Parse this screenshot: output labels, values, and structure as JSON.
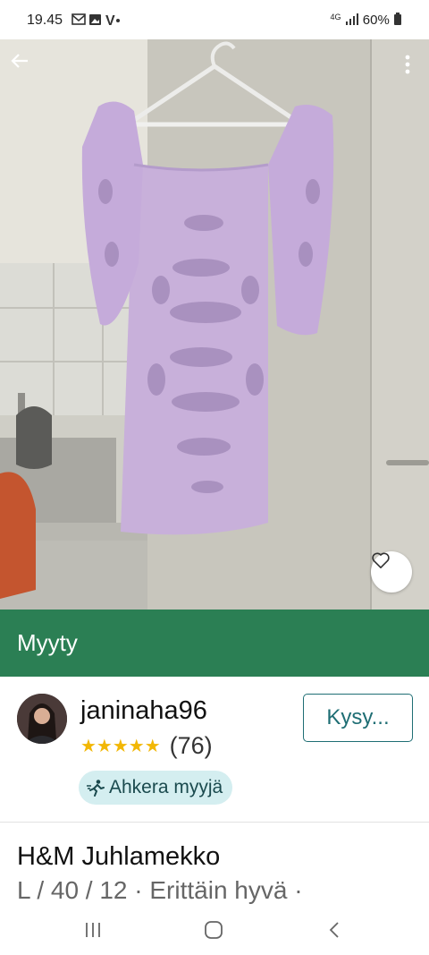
{
  "status_bar": {
    "time": "19.45",
    "notification_icons": [
      "mail-icon",
      "image-icon",
      "vinted-icon",
      "dot-icon"
    ],
    "network": "4G",
    "battery": "60%"
  },
  "photo": {
    "description_icons": [
      "back-arrow-icon",
      "more-vert-icon",
      "heart-icon"
    ]
  },
  "sold_banner": {
    "label": "Myyty",
    "color": "#2b7f54"
  },
  "seller": {
    "username": "janinaha96",
    "stars": "★★★★★",
    "rating_count": "(76)",
    "ask_button": "Kysy...",
    "badge": "Ahkera myyjä",
    "accent": "#1f6e74"
  },
  "item": {
    "title": "H&M Juhlamekko",
    "details": "L / 40 / 12 · Erittäin hyvä ·"
  }
}
